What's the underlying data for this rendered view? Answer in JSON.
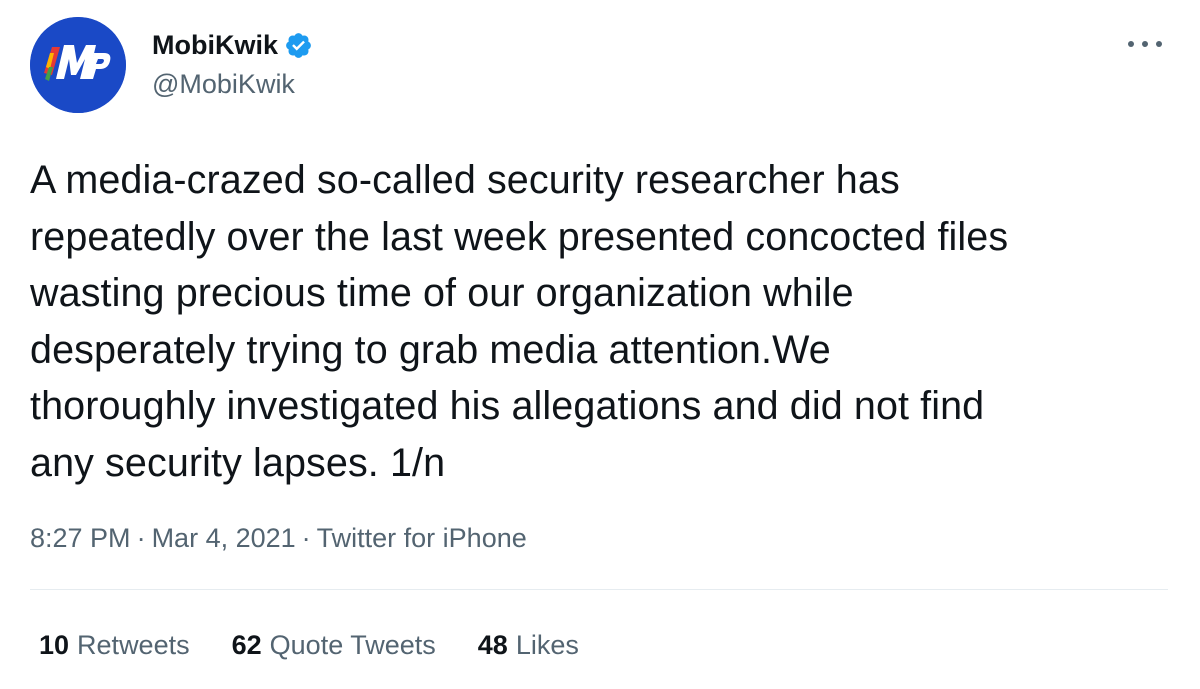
{
  "author": {
    "name": "MobiKwik",
    "handle": "@MobiKwik",
    "verified": true,
    "avatar_icon": "mobikwik-logo",
    "brand_color": "#1a49c6"
  },
  "more_menu_icon": "more-horizontal-icon",
  "tweet": {
    "lines": [
      "A media-crazed so-called security researcher has",
      "repeatedly over the last week presented concocted files",
      "wasting precious time of our organization while",
      "desperately trying to grab media attention.We",
      "thoroughly investigated his allegations and did not find",
      "any security lapses. 1/n"
    ]
  },
  "meta": {
    "time": "8:27 PM",
    "date": "Mar 4, 2021",
    "source": "Twitter for iPhone",
    "separator": "·"
  },
  "stats": {
    "retweets_count": "10",
    "retweets_label": "Retweets",
    "quote_count": "62",
    "quote_label": "Quote Tweets",
    "likes_count": "48",
    "likes_label": "Likes"
  },
  "colors": {
    "text": "#0f1419",
    "secondary": "#536471",
    "verified": "#1d9bf0",
    "divider": "#e6ecf0"
  }
}
